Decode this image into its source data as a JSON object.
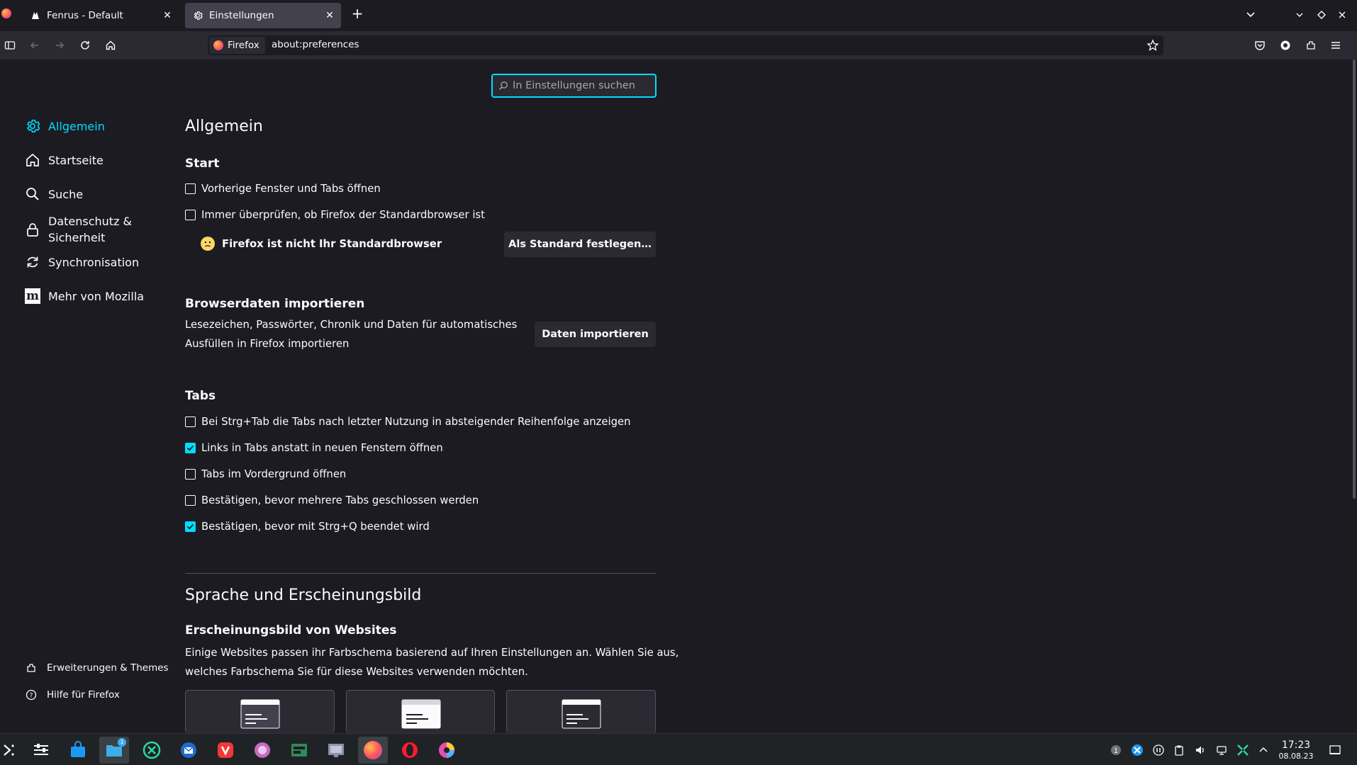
{
  "tabs": [
    {
      "title": "Fenrus - Default",
      "icon": "fenrus-icon"
    },
    {
      "title": "Einstellungen",
      "icon": "gear-icon"
    }
  ],
  "navbar": {
    "identity_label": "Firefox",
    "url": "about:preferences"
  },
  "search": {
    "placeholder": "In Einstellungen suchen"
  },
  "sidebar": {
    "items": [
      {
        "label": "Allgemein",
        "icon": "gear-icon",
        "selected": true
      },
      {
        "label": "Startseite",
        "icon": "home-icon"
      },
      {
        "label": "Suche",
        "icon": "search-icon"
      },
      {
        "label": "Datenschutz &",
        "label2": "Sicherheit",
        "icon": "lock-icon"
      },
      {
        "label": "Synchronisation",
        "icon": "sync-icon"
      },
      {
        "label": "Mehr von Mozilla",
        "icon": "mozilla-icon"
      }
    ],
    "footer": [
      {
        "label": "Erweiterungen & Themes",
        "icon": "puzzle-icon"
      },
      {
        "label": "Hilfe für Firefox",
        "icon": "help-icon"
      }
    ]
  },
  "main": {
    "title": "Allgemein",
    "start": {
      "heading": "Start",
      "options": [
        {
          "label": "Vorherige Fenster und Tabs öffnen",
          "checked": false
        },
        {
          "label": "Immer überprüfen, ob Firefox der Standardbrowser ist",
          "checked": false
        }
      ],
      "default_status": "Firefox ist nicht Ihr Standardbrowser",
      "default_button": "Als Standard festlegen…"
    },
    "import": {
      "heading": "Browserdaten importieren",
      "text_line1": "Lesezeichen, Passwörter, Chronik und Daten für automatisches",
      "text_line2": "Ausfüllen in Firefox importieren",
      "button": "Daten importieren"
    },
    "tabs_section": {
      "heading": "Tabs",
      "options": [
        {
          "label": "Bei Strg+Tab die Tabs nach letzter Nutzung in absteigender Reihenfolge anzeigen",
          "checked": false
        },
        {
          "label": "Links in Tabs anstatt in neuen Fenstern öffnen",
          "checked": true
        },
        {
          "label": "Tabs im Vordergrund öffnen",
          "checked": false
        },
        {
          "label": "Bestätigen, bevor mehrere Tabs geschlossen werden",
          "checked": false
        },
        {
          "label": "Bestätigen, bevor mit Strg+Q beendet wird",
          "checked": true
        }
      ]
    },
    "language": {
      "title": "Sprache und Erscheinungsbild",
      "appearance_heading": "Erscheinungsbild von Websites",
      "appearance_text_line1": "Einige Websites passen ihr Farbschema basierend auf Ihren Einstellungen an. Wählen Sie aus,",
      "appearance_text_line2": "welches Farbschema Sie für diese Websites verwenden möchten."
    }
  },
  "taskbar": {
    "clock_time": "17:23",
    "clock_date": "08.08.23",
    "files_badge": "1"
  },
  "colors": {
    "accent": "#00ddff",
    "background": "#1c1b22",
    "surface": "#2b2a33"
  }
}
